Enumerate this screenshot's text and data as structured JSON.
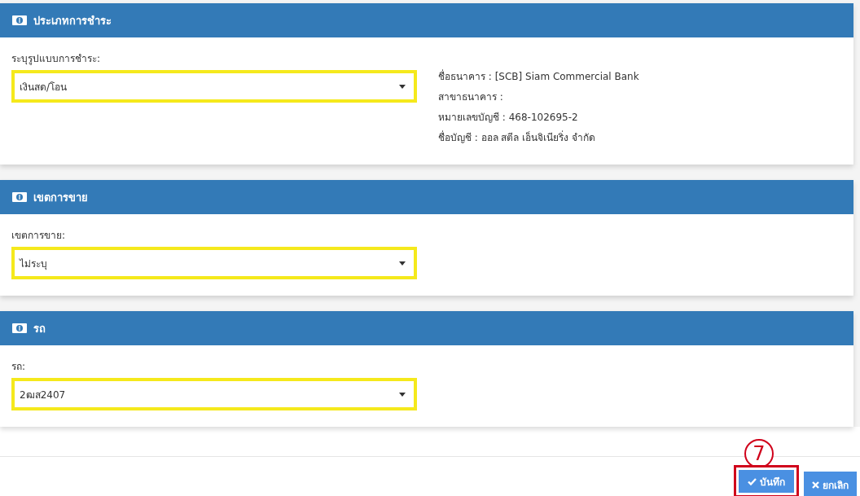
{
  "panels": [
    {
      "title": "ประเภทการชำระ",
      "field": {
        "label": "ระบุรูปแบบการชำระ:",
        "value": "เงินสด/โอน"
      },
      "info": [
        "ชื่อธนาคาร : [SCB] Siam Commercial Bank",
        "สาขาธนาคาร :",
        "หมายเลขบัญชี : 468-102695-2",
        "ชื่อบัญชี : ออล สตีล เอ็นจิเนียริ่ง จำกัด"
      ]
    },
    {
      "title": "เขตการขาย",
      "field": {
        "label": "เขตการขาย:",
        "value": "ไม่ระบุ"
      }
    },
    {
      "title": "รถ",
      "field": {
        "label": "รถ:",
        "value": "2ฒส2407"
      }
    }
  ],
  "callout": "7",
  "buttons": [
    {
      "kind": "save",
      "label": "บันทึก",
      "highlighted": true
    },
    {
      "kind": "cancel",
      "label": "ยกเลิก",
      "highlighted": false
    }
  ]
}
